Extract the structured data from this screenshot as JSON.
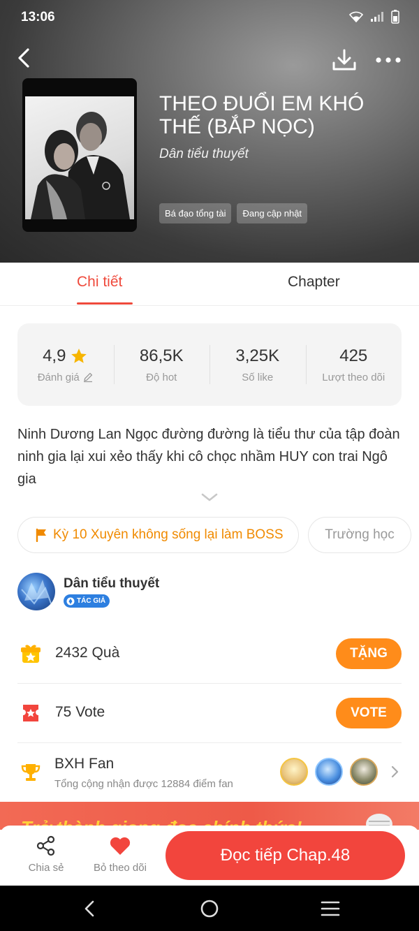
{
  "status_bar": {
    "time": "13:06"
  },
  "book": {
    "title": "THEO ĐUỔI EM KHÓ THẾ (BẮP NỌC)",
    "author": "Dân tiểu thuyết",
    "tags": [
      "Bá đạo tổng tài",
      "Đang cập nhật"
    ]
  },
  "tabs": {
    "detail": "Chi tiết",
    "chapter": "Chapter"
  },
  "stats": {
    "rating": {
      "value": "4,9",
      "label": "Đánh giá"
    },
    "hot": {
      "value": "86,5K",
      "label": "Độ hot"
    },
    "likes": {
      "value": "3,25K",
      "label": "Số like"
    },
    "follows": {
      "value": "425",
      "label": "Lượt theo dõi"
    }
  },
  "description": "Ninh Dương Lan Ngọc đường đường là tiểu thư của tập đoàn ninh gia lại xui xẻo thấy khi cô chọc nhầm HUY con trai Ngô gia",
  "chips": {
    "event": "Kỳ 10 Xuyên không sống lại làm BOSS",
    "school": "Trường học"
  },
  "author_section": {
    "name": "Dân tiểu thuyết",
    "badge": "TÁC GIẢ"
  },
  "gift": {
    "text": "2432 Quà",
    "button": "TẶNG"
  },
  "vote": {
    "text": "75 Vote",
    "button": "VOTE"
  },
  "fan": {
    "title": "BXH Fan",
    "subtitle": "Tổng cộng nhận được 12884 điểm fan"
  },
  "banner": {
    "text": "Trở thành giọng đọc chính thức!"
  },
  "bottom_bar": {
    "share": "Chia sẻ",
    "unfollow": "Bỏ theo dõi",
    "read": "Đọc tiếp Chap.48"
  },
  "colors": {
    "accent": "#ef4a3c",
    "orange": "#ff8c1a",
    "read_button": "#f2453d"
  }
}
